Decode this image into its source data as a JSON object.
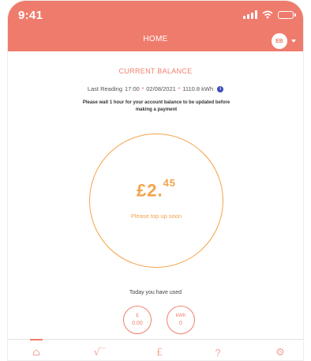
{
  "status_bar": {
    "time": "9:41"
  },
  "header": {
    "title": "HOME",
    "avatar_initials": "EB"
  },
  "balance_section": {
    "title": "CURRENT BALANCE",
    "last_reading_label": "Last Reading",
    "last_reading_time": "17:00",
    "last_reading_date": "02/08/2021",
    "last_reading_value": "1110.8 kWh",
    "notice": "Please wait 1 hour for your account balance to be updated before making a payment",
    "amount_main": "£2.",
    "amount_pence": "45",
    "topup_message": "Please top up soon"
  },
  "usage": {
    "label": "Today you have used",
    "cost_unit": "£",
    "cost_value": "0.00",
    "energy_unit": "kWh",
    "energy_value": "0"
  },
  "tabs": [
    {
      "name": "home",
      "icon": "⌂"
    },
    {
      "name": "usage",
      "icon": "√‾"
    },
    {
      "name": "payment",
      "icon": "£"
    },
    {
      "name": "help",
      "icon": "?"
    },
    {
      "name": "settings",
      "icon": "⚙"
    }
  ],
  "colors": {
    "brand": "#ef7b6c",
    "balance_accent": "#f5a24a",
    "info": "#3a4bb8"
  }
}
